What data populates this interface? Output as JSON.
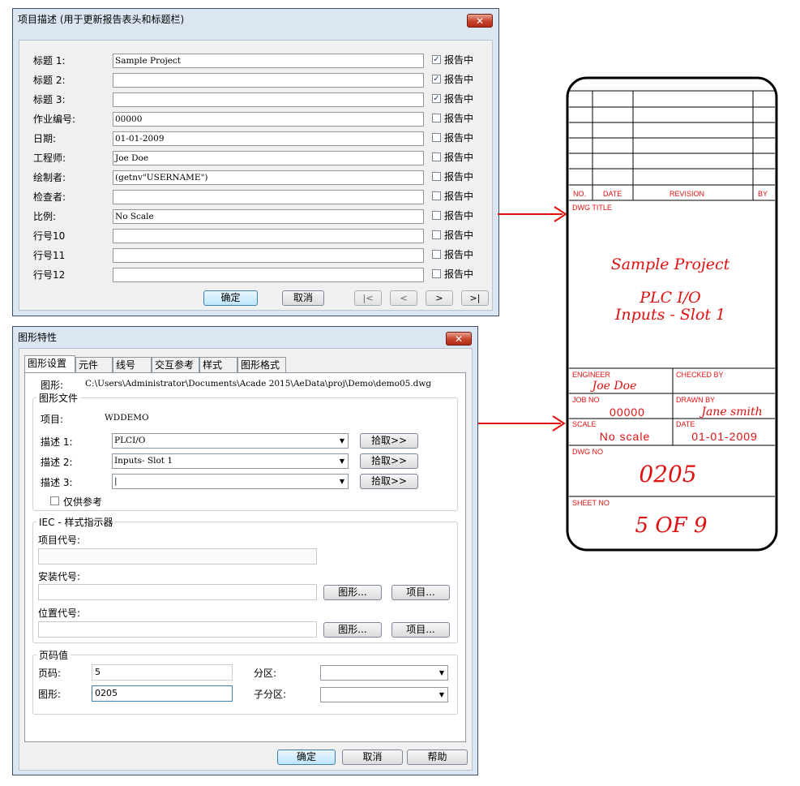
{
  "dialog1": {
    "title": "项目描述 (用于更新报告表头和标题栏)",
    "close_glyph": "✕",
    "rows": [
      {
        "label": "标题 1:",
        "value": "Sample Project",
        "checked": true
      },
      {
        "label": "标题 2:",
        "value": "",
        "checked": true
      },
      {
        "label": "标题 3:",
        "value": "",
        "checked": true
      },
      {
        "label": "作业编号:",
        "value": "00000",
        "checked": false
      },
      {
        "label": "日期:",
        "value": "01-01-2009",
        "checked": false
      },
      {
        "label": "工程师:",
        "value": "Joe Doe",
        "checked": false
      },
      {
        "label": "绘制者:",
        "value": "(getnv\"USERNAME\")",
        "checked": false
      },
      {
        "label": "检查者:",
        "value": "",
        "checked": false
      },
      {
        "label": "比例:",
        "value": "No Scale",
        "checked": false
      },
      {
        "label": "行号10",
        "value": "",
        "checked": false
      },
      {
        "label": "行号11",
        "value": "",
        "checked": false
      },
      {
        "label": "行号12",
        "value": "",
        "checked": false
      }
    ],
    "check_label": "报告中",
    "ok": "确定",
    "cancel": "取消",
    "nav": [
      "|<",
      "<",
      ">",
      ">|"
    ]
  },
  "dialog2": {
    "title": "图形特性",
    "close_glyph": "✕",
    "tabs": [
      "图形设置",
      "元件",
      "线号",
      "交互参考",
      "样式",
      "图形格式"
    ],
    "drawing_label": "图形:",
    "drawing_path": "C:\\Users\\Administrator\\Documents\\Acade 2015\\AeData\\proj\\Demo\\demo05.dwg",
    "file_group": "图形文件",
    "project_label": "项目:",
    "project_value": "WDDEMO",
    "descriptions": [
      {
        "label": "描述 1:",
        "value": "PLCI/O"
      },
      {
        "label": "描述 2:",
        "value": "Inputs- Slot 1"
      },
      {
        "label": "描述 3:",
        "value": "|"
      }
    ],
    "pick_label": "拾取>>",
    "ref_only_label": "仅供参考",
    "iec_group": "IEC - 样式指示器",
    "project_code_label": "项目代号:",
    "install_code_label": "安装代号:",
    "location_code_label": "位置代号:",
    "drawing_btn": "图形...",
    "project_btn": "项目...",
    "page_group": "页码值",
    "page_label": "页码:",
    "page_value": "5",
    "drawing_no_label": "图形:",
    "drawing_no_value": "0205",
    "section_label": "分区:",
    "subsection_label": "子分区:",
    "ok": "确定",
    "cancel": "取消",
    "help": "帮助"
  },
  "title_block": {
    "no_label": "NO.",
    "date_label": "DATE",
    "revision_label": "REVISION",
    "by_label": "BY",
    "dwg_title_label": "DWG TITLE",
    "title_line1": "Sample Project",
    "title_line2": "PLC I/O",
    "title_line3": "Inputs - Slot 1",
    "engineer_label": "ENGINEER",
    "engineer": "Joe Doe",
    "checked_by_label": "CHECKED BY",
    "job_no_label": "JOB NO",
    "job_no": "00000",
    "drawn_by_label": "DRAWN BY",
    "drawn_by": "Jane smith",
    "scale_label": "SCALE",
    "scale": "No scale",
    "date2_label": "DATE",
    "date": "01-01-2009",
    "dwg_no_label": "DWG NO",
    "dwg_no": "0205",
    "sheet_no_label": "SHEET NO",
    "sheet_no": "5 OF 9"
  },
  "colors": {
    "annotation_red": "#e01010",
    "window_frame": "#dbe6f2",
    "close_red": "#c8432b"
  }
}
